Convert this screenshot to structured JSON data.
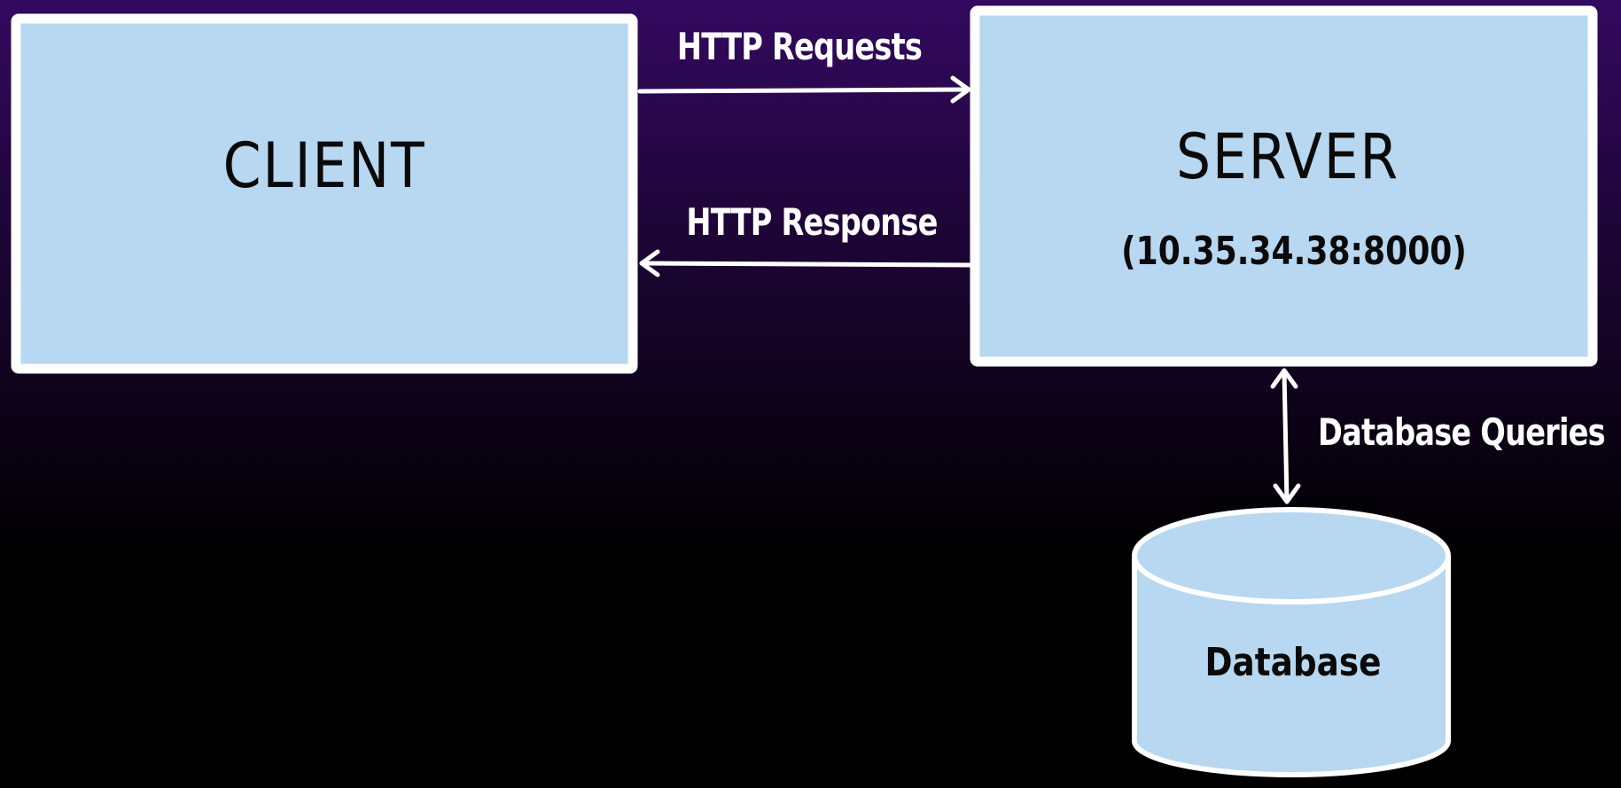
{
  "colors": {
    "background_top": "#33095f",
    "background_bottom": "#000000",
    "box_fill": "#b8d7f0",
    "box_stroke": "#ffffff",
    "text_dark": "#0a0a0a",
    "text_light": "#ffffff"
  },
  "client": {
    "title": "CLIENT"
  },
  "server": {
    "title": "SERVER",
    "address": "(10.35.34.38:8000)"
  },
  "database": {
    "label": "Database"
  },
  "edges": {
    "requests": {
      "label": "HTTP Requests"
    },
    "response": {
      "label": "HTTP Response"
    },
    "queries": {
      "label": "Database Queries"
    }
  }
}
